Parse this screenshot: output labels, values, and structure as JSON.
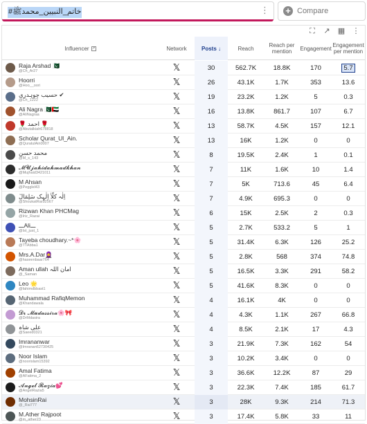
{
  "search": {
    "query": "#خاتم_النبیین_محمدﷺ"
  },
  "compare": {
    "label": "Compare"
  },
  "columns": {
    "influencer": "Influencer",
    "network": "Network",
    "posts": "Posts ↓",
    "reach": "Reach",
    "reach_per_mention": "Reach per mention",
    "engagement": "Engagement",
    "engagement_per_mention": "Engagement per mention"
  },
  "rows": [
    {
      "name": "Raja Arshad 🇵🇰",
      "handle": "@Ch_Ar27",
      "network": "𝕏",
      "posts": "30",
      "reach": "562.7K",
      "rpm": "18.8K",
      "eng": "170",
      "epm": "5.7",
      "color": "#6d5a4a"
    },
    {
      "name": "Hoorri",
      "handle": "@Hoo__oori",
      "network": "𝕏",
      "posts": "26",
      "reach": "43.1K",
      "rpm": "1.7K",
      "eng": "353",
      "epm": "13.6",
      "color": "#b59b8a"
    },
    {
      "name": "حسیب چوہدری ✔",
      "handle": "@Ch_1222",
      "network": "𝕏",
      "posts": "19",
      "reach": "23.2K",
      "rpm": "1.2K",
      "eng": "5",
      "epm": "0.3",
      "color": "#5a6e8a"
    },
    {
      "name": "Ali Nagra 🇵🇰🇦🇪",
      "handle": "@AliNagraa",
      "network": "𝕏",
      "posts": "16",
      "reach": "13.8K",
      "rpm": "861.7",
      "eng": "107",
      "epm": "6.7",
      "color": "#a0522d"
    },
    {
      "name": "🌹 احمد 🌹",
      "handle": "@Abutalkiah678818",
      "network": "𝕏",
      "posts": "13",
      "reach": "58.7K",
      "rpm": "4.5K",
      "eng": "157",
      "epm": "12.1",
      "color": "#c0392b"
    },
    {
      "name": "Scholar Qurat_Ul_Ain.",
      "handle": "@QuratulAin0007",
      "network": "𝕏",
      "posts": "13",
      "reach": "16K",
      "rpm": "1.2K",
      "eng": "0",
      "epm": "0",
      "color": "#8e6e53"
    },
    {
      "name": "محمد حسن",
      "handle": "@M_s_143",
      "network": "𝕏",
      "posts": "8",
      "reach": "19.5K",
      "rpm": "2.4K",
      "eng": "1",
      "epm": "0.1",
      "color": "#4a4a4a"
    },
    {
      "name": "𝓜𝓤𝓳𝓪𝓱𝓲𝓭𝓪𝓱𝓶𝓪𝓭𝓴𝓱𝓪𝓷",
      "handle": "@Mujhaid3421011",
      "network": "𝕏",
      "posts": "7",
      "reach": "11K",
      "rpm": "1.6K",
      "eng": "10",
      "epm": "1.4",
      "color": "#2c2c2c"
    },
    {
      "name": "M Ahsan",
      "handle": "@Pegglel43",
      "network": "𝕏",
      "posts": "7",
      "reach": "5K",
      "rpm": "713.6",
      "eng": "45",
      "epm": "6.4",
      "color": "#1a1a1a"
    },
    {
      "name": "اِلٰہ کلّاٰ اِلٰہِک سَلِمَالٓ",
      "handle": "@ShoukatRar32567",
      "network": "𝕏",
      "posts": "7",
      "reach": "4.9K",
      "rpm": "695.3",
      "eng": "0",
      "epm": "0",
      "color": "#7f8c8d"
    },
    {
      "name": "Rizwan Khan PHCMag",
      "handle": "@Iriz_Razai",
      "network": "𝕏",
      "posts": "6",
      "reach": "15K",
      "rpm": "2.5K",
      "eng": "2",
      "epm": "0.3",
      "color": "#95a5a6"
    },
    {
      "name": "ـــAliـــ",
      "handle": "@Ist_just_1",
      "network": "𝕏",
      "posts": "5",
      "reach": "2.7K",
      "rpm": "533.2",
      "eng": "5",
      "epm": "1",
      "color": "#3f51b5"
    },
    {
      "name": "Tayeba choudhary.~*🌸",
      "handle": "@TTAbba1",
      "network": "𝕏",
      "posts": "5",
      "reach": "31.4K",
      "rpm": "6.3K",
      "eng": "126",
      "epm": "25.2",
      "color": "#b97a57"
    },
    {
      "name": "Mrs.A.Dar🧕",
      "handle": "@haseenbaar764",
      "network": "𝕏",
      "posts": "5",
      "reach": "2.8K",
      "rpm": "568",
      "eng": "374",
      "epm": "74.8",
      "color": "#d35400"
    },
    {
      "name": "Aman ullah امان اللہ",
      "handle": "@_Saman",
      "network": "𝕏",
      "posts": "5",
      "reach": "16.5K",
      "rpm": "3.3K",
      "eng": "291",
      "epm": "58.2",
      "color": "#7d6b5d"
    },
    {
      "name": "Leo 🌟",
      "handle": "@fahimdbbast1",
      "network": "𝕏",
      "posts": "5",
      "reach": "41.6K",
      "rpm": "8.3K",
      "eng": "0",
      "epm": "0",
      "color": "#2e86c1"
    },
    {
      "name": "Muhammad RafiqMemon",
      "handle": "@Khandawala",
      "network": "𝕏",
      "posts": "4",
      "reach": "16.1K",
      "rpm": "4K",
      "eng": "0",
      "epm": "0",
      "color": "#566573"
    },
    {
      "name": "𝓓𝓻 𝓜𝓾𝓭𝓪𝓼𝓼𝓲𝓻𝓪🌸🎀",
      "handle": "@DrMdasira",
      "network": "𝕏",
      "posts": "4",
      "reach": "4.3K",
      "rpm": "1.1K",
      "eng": "267",
      "epm": "66.8",
      "color": "#c39bd3"
    },
    {
      "name": "علی شاہ",
      "handle": "@Saeed0321",
      "network": "𝕏",
      "posts": "4",
      "reach": "8.5K",
      "rpm": "2.1K",
      "eng": "17",
      "epm": "4.3",
      "color": "#909497"
    },
    {
      "name": "Imrananwar",
      "handle": "@Imranan62730425",
      "network": "𝕏",
      "posts": "3",
      "reach": "21.9K",
      "rpm": "7.3K",
      "eng": "162",
      "epm": "54",
      "color": "#34495e"
    },
    {
      "name": "Noor Islam",
      "handle": "@noorislam15392",
      "network": "𝕏",
      "posts": "3",
      "reach": "10.2K",
      "rpm": "3.4K",
      "eng": "0",
      "epm": "0",
      "color": "#5d6d7e"
    },
    {
      "name": "Amal Fatima",
      "handle": "@AFatima_2",
      "network": "𝕏",
      "posts": "3",
      "reach": "36.6K",
      "rpm": "12.2K",
      "eng": "87",
      "epm": "29",
      "color": "#a04000"
    },
    {
      "name": "𝓐𝓷𝓰𝓮𝓵 𝓡𝓪𝔃𝓲𝓪💕",
      "handle": "@AngelRazia5",
      "network": "𝕏",
      "posts": "3",
      "reach": "22.3K",
      "rpm": "7.4K",
      "eng": "185",
      "epm": "61.7",
      "color": "#1c1c1c"
    },
    {
      "name": "MohsinRai",
      "handle": "@_Rai777",
      "network": "𝕏",
      "posts": "3",
      "reach": "28K",
      "rpm": "9.3K",
      "eng": "214",
      "epm": "71.3",
      "color": "#6e2c00"
    },
    {
      "name": "M.Ather Rajpoot",
      "handle": "@m_ather23",
      "network": "𝕏",
      "posts": "3",
      "reach": "17.4K",
      "rpm": "5.8K",
      "eng": "33",
      "epm": "11",
      "color": "#4d5656"
    }
  ]
}
